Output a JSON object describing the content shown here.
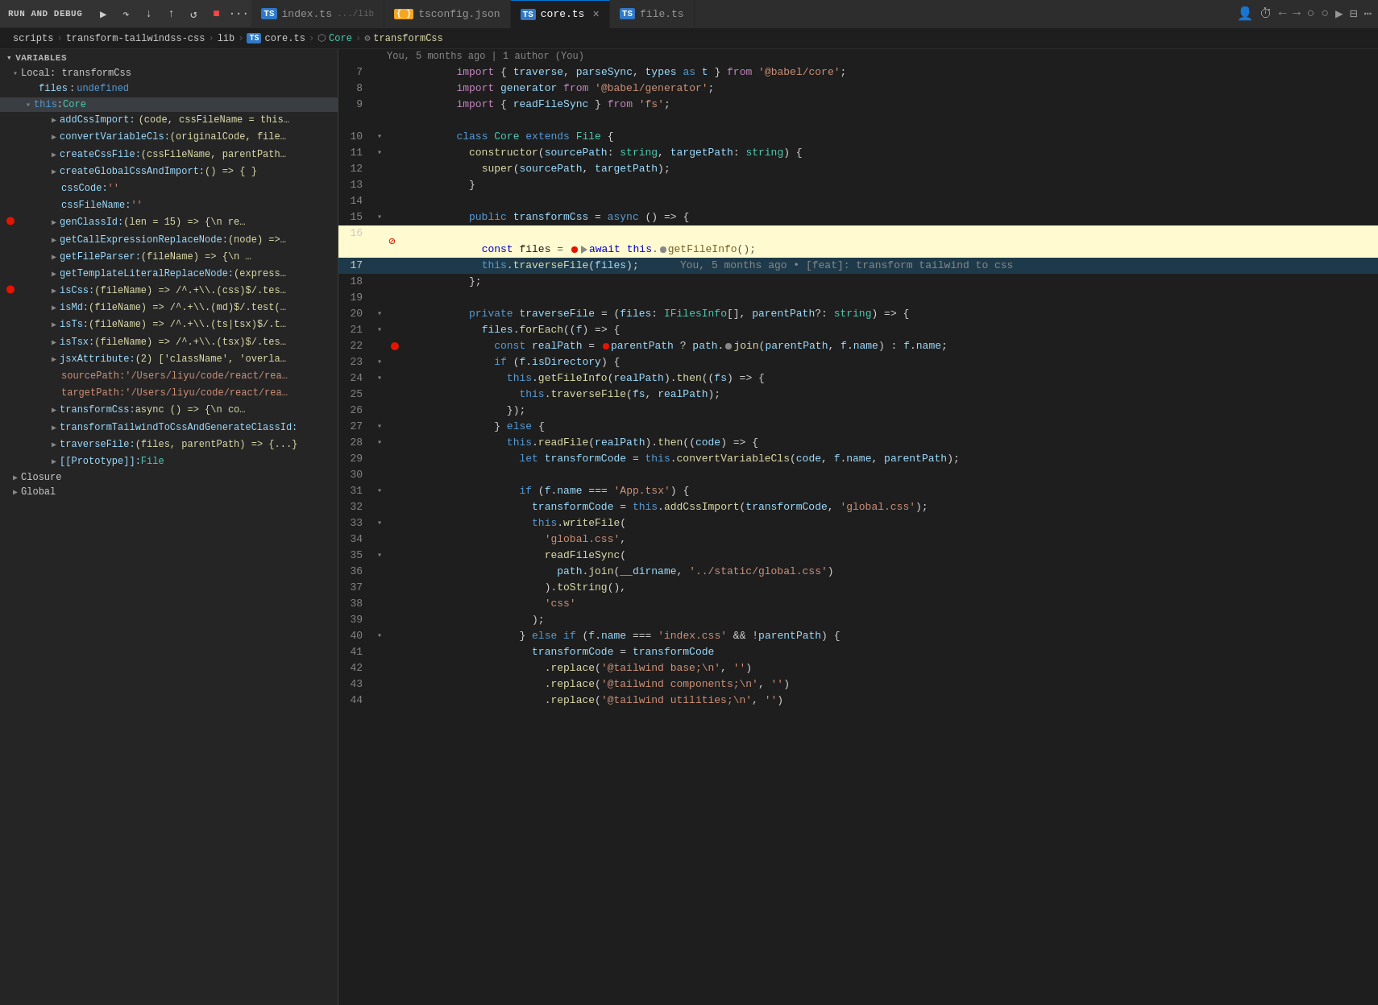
{
  "topbar": {
    "run_debug": "RUN AND DEBUG",
    "tabs": [
      {
        "id": "index",
        "icon": "ts",
        "label": "index.ts",
        "sublabel": ".../lib",
        "active": false
      },
      {
        "id": "tsconfig",
        "icon": "json",
        "label": "tsconfig.json",
        "active": false
      },
      {
        "id": "core",
        "icon": "ts",
        "label": "core.ts",
        "active": true,
        "closeable": true
      },
      {
        "id": "file",
        "icon": "ts",
        "label": "file.ts",
        "active": false
      }
    ]
  },
  "breadcrumb": {
    "parts": [
      "scripts",
      "transform-tailwindss-css",
      "lib",
      "core.ts",
      "Core",
      "transformCss"
    ]
  },
  "sidebar": {
    "sections": {
      "variables_label": "VARIABLES",
      "local_label": "Local: transformCss",
      "files_key": "files",
      "files_val": "undefined",
      "this_label": "this: Core",
      "items": [
        {
          "key": "addCssImport:",
          "val": "(code, cssFileName = this...",
          "has_arrow": true,
          "indent": 1
        },
        {
          "key": "convertVariableCls:",
          "val": "(originalCode, file...",
          "has_arrow": true,
          "indent": 1
        },
        {
          "key": "createCssFile:",
          "val": "(cssFileName, parentPath...",
          "has_arrow": true,
          "indent": 1
        },
        {
          "key": "createGlobalCssAndImport:",
          "val": "() => { }",
          "has_arrow": true,
          "indent": 1
        },
        {
          "key": "cssCode:",
          "val": "''",
          "indent": 1,
          "val_type": "string"
        },
        {
          "key": "cssFileName:",
          "val": "''",
          "indent": 1,
          "val_type": "string"
        },
        {
          "key": "genClassId:",
          "val": "(len = 15) => {\\n    re...",
          "has_arrow": true,
          "indent": 1,
          "has_red_dot": true
        },
        {
          "key": "getCallExpressionReplaceNode:",
          "val": "(node) =>...",
          "has_arrow": true,
          "indent": 1
        },
        {
          "key": "getFileParser:",
          "val": "(fileName) => {\\n    ...",
          "has_arrow": true,
          "indent": 1
        },
        {
          "key": "getTemplateLiteralReplaceNode:",
          "val": "(express...",
          "has_arrow": true,
          "indent": 1
        },
        {
          "key": "isCss:",
          "val": "(fileName) => /^.+\\\\.(css)$/.tes...",
          "has_arrow": true,
          "indent": 1,
          "has_red_dot": true
        },
        {
          "key": "isMd:",
          "val": "(fileName) => /^.+\\\\.(md)$/.test(...",
          "has_arrow": true,
          "indent": 1
        },
        {
          "key": "isTs:",
          "val": "(fileName) => /^.+\\\\.(ts|tsx)$/.t...",
          "has_arrow": true,
          "indent": 1
        },
        {
          "key": "isTsx:",
          "val": "(fileName) => /^.+\\\\.(tsx)$/.tes...",
          "has_arrow": true,
          "indent": 1
        },
        {
          "key": "jsxAttribute:",
          "val": "(2) ['className', 'overla...",
          "has_arrow": true,
          "indent": 1
        },
        {
          "key": "sourcePath:",
          "val": "'/Users/liyu/code/react/rea...",
          "indent": 1,
          "val_type": "path"
        },
        {
          "key": "targetPath:",
          "val": "'/Users/liyu/code/react/rea...",
          "indent": 1,
          "val_type": "path"
        },
        {
          "key": "transformCss:",
          "val": "async () => {\\n    co...",
          "has_arrow": true,
          "indent": 1
        },
        {
          "key": "transformTailwindToCssAndGenerateClassId:",
          "val": "",
          "has_arrow": true,
          "indent": 1
        },
        {
          "key": "traverseFile:",
          "val": "(files, parentPath) => {...}",
          "has_arrow": true,
          "indent": 1
        },
        {
          "key": "[[Prototype]]:",
          "val": "File",
          "has_arrow": true,
          "indent": 1
        }
      ],
      "closure_label": "Closure",
      "global_label": "Global"
    }
  },
  "editor": {
    "git_blame": "You, 5 months ago | 1 author (You)",
    "lines": [
      {
        "num": 7,
        "text": "import { traverse, parseSync, types as t } from '@babel/core';",
        "indent": 2
      },
      {
        "num": 8,
        "text": "import generator from '@babel/generator';",
        "indent": 2
      },
      {
        "num": 9,
        "text": "import { readFileSync } from 'fs';",
        "indent": 2
      },
      {
        "num": 10
      },
      {
        "num": 10,
        "text": "class Core extends File {",
        "is_class": true
      },
      {
        "num": 11,
        "text": "  constructor(sourcePath: string, targetPath: string) {",
        "is_constructor": true,
        "has_fold": true
      },
      {
        "num": 12,
        "text": "    super(sourcePath, targetPath);"
      },
      {
        "num": 13,
        "text": "  }"
      },
      {
        "num": 14
      },
      {
        "num": 15,
        "text": "  public transformCss = async () => {",
        "has_fold": true
      },
      {
        "num": 16,
        "text": "    const files = await this.getFileInfo();",
        "is_debug": true,
        "has_breakpoint_pause": true
      },
      {
        "num": 17,
        "text": "    this.traverseFile(files);",
        "is_debug_next": true
      },
      {
        "num": 18,
        "text": "  };"
      },
      {
        "num": 19
      },
      {
        "num": 20,
        "text": "  private traverseFile = (files: IFilesInfo[], parentPath?: string) => {",
        "has_fold": true
      },
      {
        "num": 21,
        "text": "    files.forEach((f) => {",
        "has_fold": true
      },
      {
        "num": 22,
        "text": "      const realPath = parentPath ? path.join(parentPath, f.name) : f.name;",
        "has_breakpoint": true
      },
      {
        "num": 23,
        "text": "      if (f.isDirectory) {",
        "has_fold": true
      },
      {
        "num": 24,
        "text": "        this.getFileInfo(realPath).then((fs) => {",
        "has_fold": true
      },
      {
        "num": 25,
        "text": "          this.traverseFile(fs, realPath);"
      },
      {
        "num": 26,
        "text": "        });"
      },
      {
        "num": 27,
        "text": "      } else {",
        "has_fold": true
      },
      {
        "num": 28,
        "text": "        this.readFile(realPath).then((code) => {",
        "has_fold": true
      },
      {
        "num": 29,
        "text": "          let transformCode = this.convertVariableCls(code, f.name, parentPath);"
      },
      {
        "num": 30
      },
      {
        "num": 31,
        "text": "          if (f.name === 'App.tsx') {",
        "has_fold": true
      },
      {
        "num": 32,
        "text": "            transformCode = this.addCssImport(transformCode, 'global.css');"
      },
      {
        "num": 33,
        "text": "            this.writeFile(",
        "has_fold": true
      },
      {
        "num": 34,
        "text": "              'global.css',"
      },
      {
        "num": 35,
        "text": "              readFileSync(",
        "has_fold": true
      },
      {
        "num": 36,
        "text": "                path.join(__dirname, '../static/global.css')"
      },
      {
        "num": 37,
        "text": "              ).toString(),"
      },
      {
        "num": 38,
        "text": "              'css'"
      },
      {
        "num": 39,
        "text": "            );"
      },
      {
        "num": 40,
        "text": "        } else if (f.name === 'index.css' && !parentPath) {",
        "has_fold": true
      },
      {
        "num": 41,
        "text": "          transformCode = transformCode"
      },
      {
        "num": 42,
        "text": "            .replace('@tailwind base;\\n', '')"
      },
      {
        "num": 43,
        "text": "            .replace('@tailwind components;\\n', '')"
      },
      {
        "num": 44,
        "text": "            .replace('@tailwind utilities;\\n', '')"
      }
    ]
  }
}
